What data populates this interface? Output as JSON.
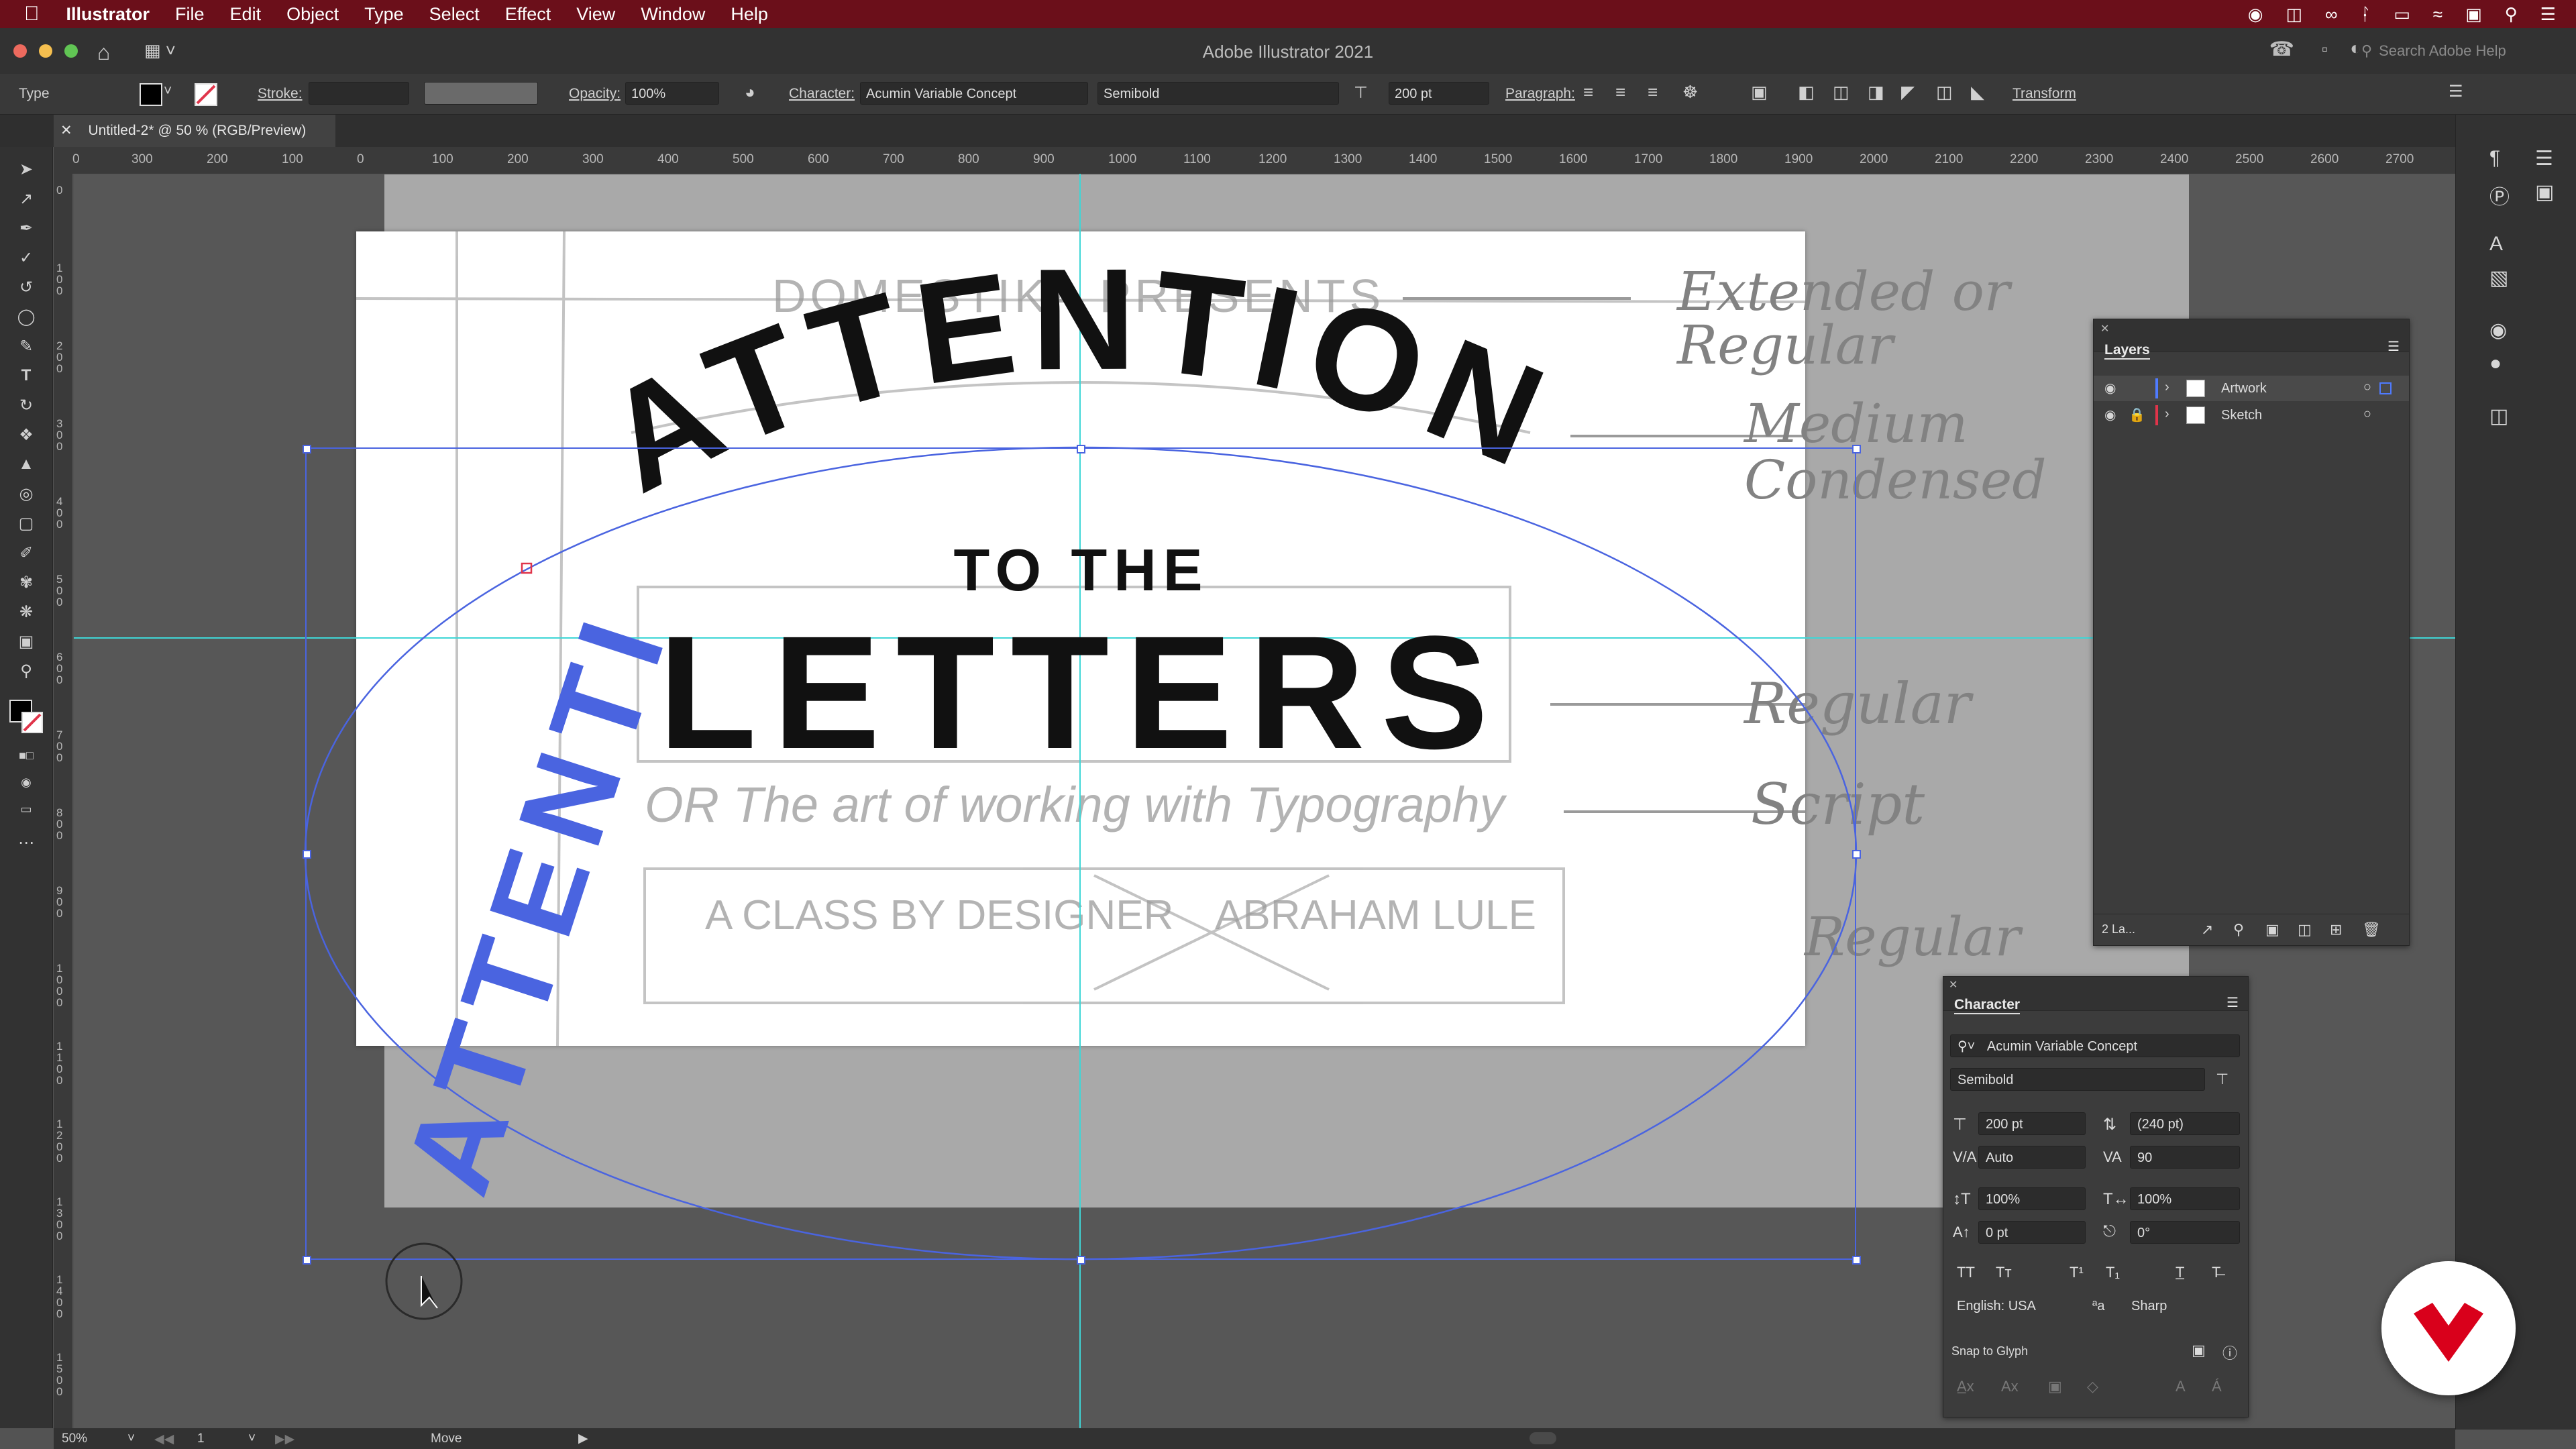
{
  "menubar": {
    "app": "Illustrator",
    "items": [
      "File",
      "Edit",
      "Object",
      "Type",
      "Select",
      "Effect",
      "View",
      "Window",
      "Help"
    ]
  },
  "titlebar": {
    "title": "Adobe Illustrator 2021",
    "search_placeholder": "Search Adobe Help"
  },
  "controlbar": {
    "tool_label": "Type",
    "stroke_label": "Stroke:",
    "opacity_label": "Opacity:",
    "opacity_value": "100%",
    "character_label": "Character:",
    "font_family": "Acumin Variable Concept",
    "font_style": "Semibold",
    "font_size": "200 pt",
    "paragraph_label": "Paragraph:",
    "transform_label": "Transform"
  },
  "document": {
    "tab_title": "Untitled-2* @ 50 % (RGB/Preview)"
  },
  "ruler": {
    "h_ticks": [
      "0",
      "300",
      "200",
      "100",
      "0",
      "100",
      "200",
      "300",
      "400",
      "500",
      "600",
      "700",
      "800",
      "900",
      "1000",
      "1100",
      "1200",
      "1300",
      "1400",
      "1500",
      "1600",
      "1700",
      "1800",
      "1900",
      "2000",
      "2100",
      "2200",
      "2300",
      "2400",
      "2500",
      "2600",
      "2700"
    ],
    "v_ticks": [
      "0",
      "1\n0\n0",
      "2\n0\n0",
      "3\n0\n0",
      "4\n0\n0",
      "5\n0\n0",
      "6\n0\n0",
      "7\n0\n0",
      "8\n0\n0",
      "9\n0\n0",
      "1\n0\n0\n0",
      "1\n1\n0\n0",
      "1\n2\n0\n0",
      "1\n3\n0\n0",
      "1\n4\n0\n0",
      "1\n5\n0\n0"
    ]
  },
  "artwork": {
    "headline_arc": "ATTENTION",
    "subline": "TO THE",
    "main_word": "LETTERS",
    "rotated_text": "ATTENTI",
    "text_color": "#111111",
    "path_text_color": "#4a64e0"
  },
  "sketch_notes": {
    "line1": "DOMESTIKA PRESENTS",
    "line1_note": "Extended or Regular",
    "line2_note": "Medium Condensed",
    "line3_note": "Regular",
    "line4": "OR The art of working with Typography",
    "line4_note": "Script",
    "box_left": "A CLASS BY DESIGNER",
    "box_right": "ABRAHAM LULE",
    "box_note": "Regular"
  },
  "layers_panel": {
    "title": "Layers",
    "layers": [
      {
        "name": "Artwork",
        "color": "#4f7bff"
      },
      {
        "name": "Sketch",
        "color": "#e0344a"
      }
    ],
    "footer": "2 La..."
  },
  "character_panel": {
    "title": "Character",
    "font_family": "Acumin Variable Concept",
    "font_style": "Semibold",
    "size": "200 pt",
    "leading": "(240 pt)",
    "kerning": "Auto",
    "tracking": "90",
    "vscale": "100%",
    "hscale": "100%",
    "baseline": "0 pt",
    "rotation": "0°",
    "language": "English: USA",
    "antialias": "Sharp",
    "snap_label": "Snap to Glyph"
  },
  "statusbar": {
    "zoom": "50%",
    "artboard": "1",
    "mode": "Move"
  },
  "colors": {
    "menubar": "#6b0f1a",
    "selection": "#4a64e0",
    "guide": "#3fd6d6",
    "domestika_red": "#d9001b"
  }
}
